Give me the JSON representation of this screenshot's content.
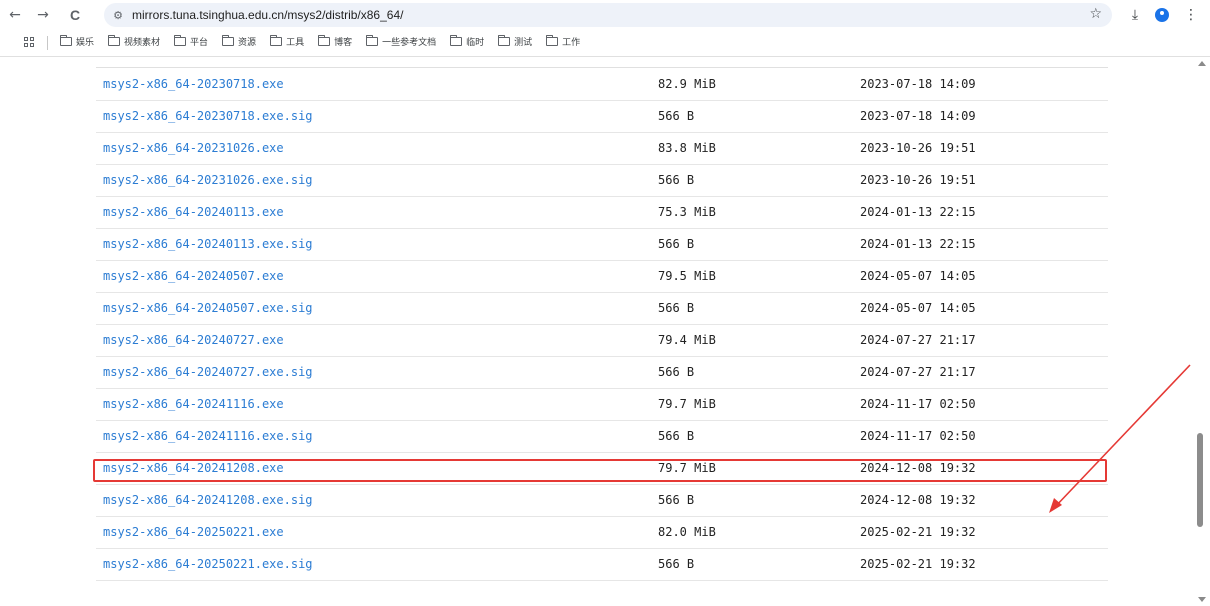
{
  "browser": {
    "url": "mirrors.tuna.tsinghua.edu.cn/msys2/distrib/x86_64/",
    "back_icon": "←",
    "forward_icon": "→",
    "reload_icon": "C",
    "site_info_icon": "⚙",
    "star_icon": "☆",
    "download_icon": "⤓",
    "menu_icon": "⋮"
  },
  "bookmarks": [
    {
      "label": "娱乐"
    },
    {
      "label": "视频素材"
    },
    {
      "label": "平台"
    },
    {
      "label": "资源"
    },
    {
      "label": "工具"
    },
    {
      "label": "博客"
    },
    {
      "label": "一些参考文档"
    },
    {
      "label": "临时"
    },
    {
      "label": "测试"
    },
    {
      "label": "工作"
    }
  ],
  "files": [
    {
      "name": "msys2-x86_64-20230718.exe",
      "size": "82.9 MiB",
      "date": "2023-07-18 14:09"
    },
    {
      "name": "msys2-x86_64-20230718.exe.sig",
      "size": "566 B",
      "date": "2023-07-18 14:09"
    },
    {
      "name": "msys2-x86_64-20231026.exe",
      "size": "83.8 MiB",
      "date": "2023-10-26 19:51"
    },
    {
      "name": "msys2-x86_64-20231026.exe.sig",
      "size": "566 B",
      "date": "2023-10-26 19:51"
    },
    {
      "name": "msys2-x86_64-20240113.exe",
      "size": "75.3 MiB",
      "date": "2024-01-13 22:15"
    },
    {
      "name": "msys2-x86_64-20240113.exe.sig",
      "size": "566 B",
      "date": "2024-01-13 22:15"
    },
    {
      "name": "msys2-x86_64-20240507.exe",
      "size": "79.5 MiB",
      "date": "2024-05-07 14:05"
    },
    {
      "name": "msys2-x86_64-20240507.exe.sig",
      "size": "566 B",
      "date": "2024-05-07 14:05"
    },
    {
      "name": "msys2-x86_64-20240727.exe",
      "size": "79.4 MiB",
      "date": "2024-07-27 21:17"
    },
    {
      "name": "msys2-x86_64-20240727.exe.sig",
      "size": "566 B",
      "date": "2024-07-27 21:17"
    },
    {
      "name": "msys2-x86_64-20241116.exe",
      "size": "79.7 MiB",
      "date": "2024-11-17 02:50"
    },
    {
      "name": "msys2-x86_64-20241116.exe.sig",
      "size": "566 B",
      "date": "2024-11-17 02:50"
    },
    {
      "name": "msys2-x86_64-20241208.exe",
      "size": "79.7 MiB",
      "date": "2024-12-08 19:32"
    },
    {
      "name": "msys2-x86_64-20241208.exe.sig",
      "size": "566 B",
      "date": "2024-12-08 19:32"
    },
    {
      "name": "msys2-x86_64-20250221.exe",
      "size": "82.0 MiB",
      "date": "2025-02-21 19:32"
    },
    {
      "name": "msys2-x86_64-20250221.exe.sig",
      "size": "566 B",
      "date": "2025-02-21 19:32"
    }
  ],
  "colors": {
    "link": "#2b7cd3",
    "annotation": "#e53935"
  }
}
